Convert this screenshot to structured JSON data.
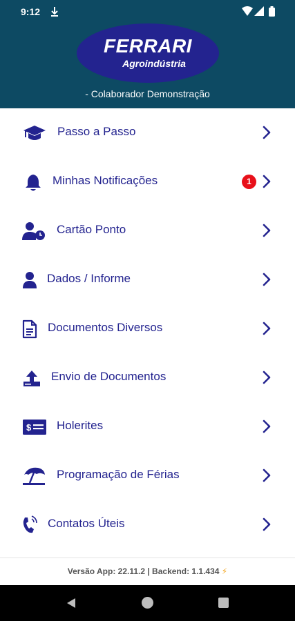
{
  "status_bar": {
    "time": "9:12",
    "icons": [
      "download-icon",
      "wifi-icon",
      "signal-icon",
      "battery-icon"
    ]
  },
  "header": {
    "logo_main": "FERRARI",
    "logo_sub": "Agroindústria",
    "user": "- Colaborador Demonstração",
    "background_color": "#0d4a63",
    "logo_color": "#23238f"
  },
  "menu": {
    "items": [
      {
        "label": "Passo a Passo",
        "icon": "graduation-cap-icon"
      },
      {
        "label": "Minhas Notificações",
        "icon": "bell-icon",
        "badge": "1"
      },
      {
        "label": "Cartão Ponto",
        "icon": "user-clock-icon"
      },
      {
        "label": "Dados / Informe",
        "icon": "user-icon"
      },
      {
        "label": "Documentos Diversos",
        "icon": "document-icon"
      },
      {
        "label": "Envio de Documentos",
        "icon": "upload-icon"
      },
      {
        "label": "Holerites",
        "icon": "money-check-icon"
      },
      {
        "label": "Programação de Férias",
        "icon": "beach-umbrella-icon"
      },
      {
        "label": "Contatos Úteis",
        "icon": "phone-icon"
      }
    ],
    "text_color": "#23238f",
    "badge_color": "#e8101a"
  },
  "footer": {
    "version": "Versão App: 22.11.2 | Backend: 1.1.434",
    "bolt": "⚡"
  },
  "nav_bar": {
    "icons": [
      "back-icon",
      "home-icon",
      "recents-icon"
    ]
  }
}
